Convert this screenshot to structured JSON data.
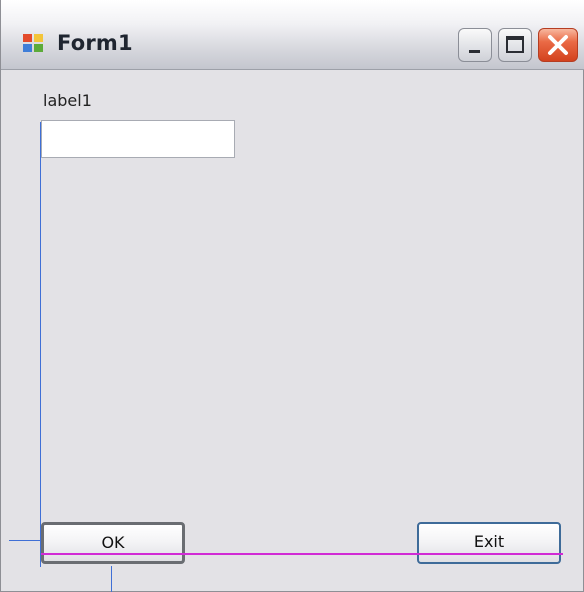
{
  "window": {
    "title": "Form1",
    "controls": {
      "minimize_icon": "minimize-icon",
      "maximize_icon": "maximize-icon",
      "close_icon": "close-icon"
    }
  },
  "form": {
    "label": "label1",
    "textbox_value": "",
    "ok_label": "OK",
    "exit_label": "Exit"
  },
  "colors": {
    "selection_guide": "#3f6fd6",
    "snapline": "#d12bd5",
    "close_button": "#d3421e"
  }
}
